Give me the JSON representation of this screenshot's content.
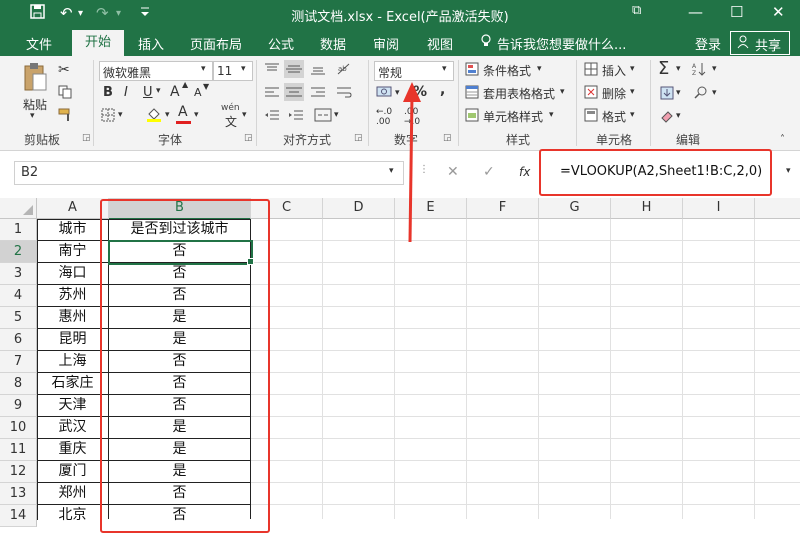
{
  "window": {
    "title": "测试文档.xlsx - Excel(产品激活失败)",
    "minimize": "—",
    "maximize": "☐",
    "close": "✕",
    "restore_ribbon": "⧉"
  },
  "quick_access": {
    "save_icon": "save-icon",
    "undo": "↶",
    "redo": "↷",
    "more": "▾"
  },
  "tabs": [
    "文件",
    "开始",
    "插入",
    "页面布局",
    "公式",
    "数据",
    "审阅",
    "视图"
  ],
  "tell_me": "告诉我您想要做什么...",
  "login": "登录",
  "share": "共享",
  "ribbon": {
    "paste": "粘贴",
    "font_name": "微软雅黑",
    "font_size": "11",
    "bold": "B",
    "italic": "I",
    "underline": "U",
    "grow_font": "A",
    "shrink_font": "A",
    "wen": "wén",
    "number_format": "常规",
    "percent": "%",
    "comma": ",",
    "cond_format": "条件格式",
    "table_format": "套用表格格式",
    "cell_styles": "单元格样式",
    "insert": "插入",
    "delete": "删除",
    "format": "格式",
    "sum": "Σ",
    "groups": {
      "clipboard": "剪贴板",
      "font": "字体",
      "alignment": "对齐方式",
      "number": "数字",
      "styles": "样式",
      "cells": "单元格",
      "editing": "编辑"
    }
  },
  "formula_bar": {
    "name_box": "B2",
    "cancel": "✕",
    "enter": "✓",
    "fx": "fx",
    "formula": "=VLOOKUP(A2,Sheet1!B:C,2,0)"
  },
  "columns": [
    "A",
    "B",
    "C",
    "D",
    "E",
    "F",
    "G",
    "H",
    "I"
  ],
  "rows": [
    {
      "n": "1",
      "a": "城市",
      "b": "是否到过该城市"
    },
    {
      "n": "2",
      "a": "南宁",
      "b": "否"
    },
    {
      "n": "3",
      "a": "海口",
      "b": "否"
    },
    {
      "n": "4",
      "a": "苏州",
      "b": "否"
    },
    {
      "n": "5",
      "a": "惠州",
      "b": "是"
    },
    {
      "n": "6",
      "a": "昆明",
      "b": "是"
    },
    {
      "n": "7",
      "a": "上海",
      "b": "否"
    },
    {
      "n": "8",
      "a": "石家庄",
      "b": "否"
    },
    {
      "n": "9",
      "a": "天津",
      "b": "否"
    },
    {
      "n": "10",
      "a": "武汉",
      "b": "是"
    },
    {
      "n": "11",
      "a": "重庆",
      "b": "是"
    },
    {
      "n": "12",
      "a": "厦门",
      "b": "是"
    },
    {
      "n": "13",
      "a": "郑州",
      "b": "否"
    },
    {
      "n": "14",
      "a": "北京",
      "b": "否"
    }
  ],
  "colors": {
    "excel_green": "#217346",
    "annotation_red": "#e8352b",
    "selection_green": "#217346"
  }
}
